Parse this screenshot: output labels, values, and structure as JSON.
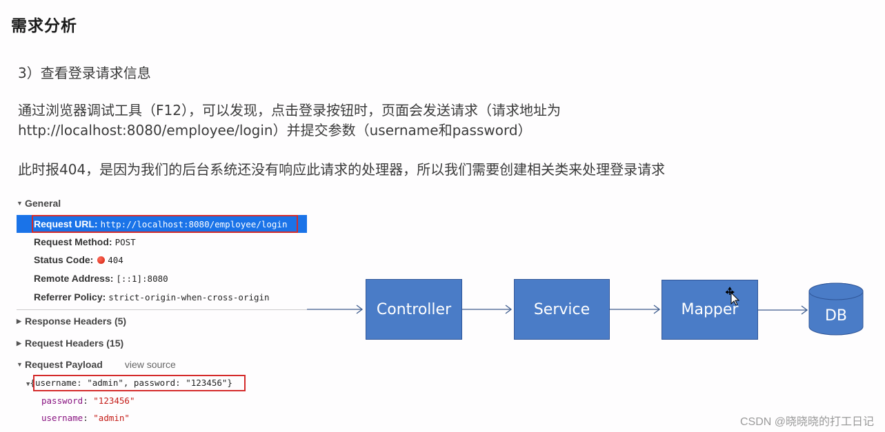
{
  "title": "需求分析",
  "step": "3）查看登录请求信息",
  "paragraphs": {
    "p1_line1": "通过浏览器调试工具（F12），可以发现，点击登录按钮时，页面会发送请求（请求地址为",
    "p1_line2": "http://localhost:8080/employee/login）并提交参数（username和password）",
    "p2": "此时报404，是因为我们的后台系统还没有响应此请求的处理器，所以我们需要创建相关类来处理登录请求"
  },
  "devtools": {
    "general": {
      "label": "General",
      "rows": [
        {
          "key": "Request URL:",
          "value": "http://localhost:8080/employee/login"
        },
        {
          "key": "Request Method:",
          "value": "POST"
        },
        {
          "key": "Status Code:",
          "value": "404"
        },
        {
          "key": "Remote Address:",
          "value": "[::1]:8080"
        },
        {
          "key": "Referrer Policy:",
          "value": "strict-origin-when-cross-origin"
        }
      ]
    },
    "response_headers": "Response Headers (5)",
    "request_headers": "Request Headers (15)",
    "request_payload": {
      "label": "Request Payload",
      "view_source": "view source",
      "summary": "{username: \"admin\", password: \"123456\"}",
      "fields": [
        {
          "key": "password",
          "value": "\"123456\""
        },
        {
          "key": "username",
          "value": "\"admin\""
        }
      ]
    }
  },
  "diagram": {
    "nodes": [
      "Controller",
      "Service",
      "Mapper",
      "DB"
    ],
    "colors": {
      "box_fill": "#4a7cc7",
      "box_border": "#2f5597",
      "arrow": "#3b5a8c"
    }
  },
  "watermark": "CSDN @晓晓晓的打工日记"
}
